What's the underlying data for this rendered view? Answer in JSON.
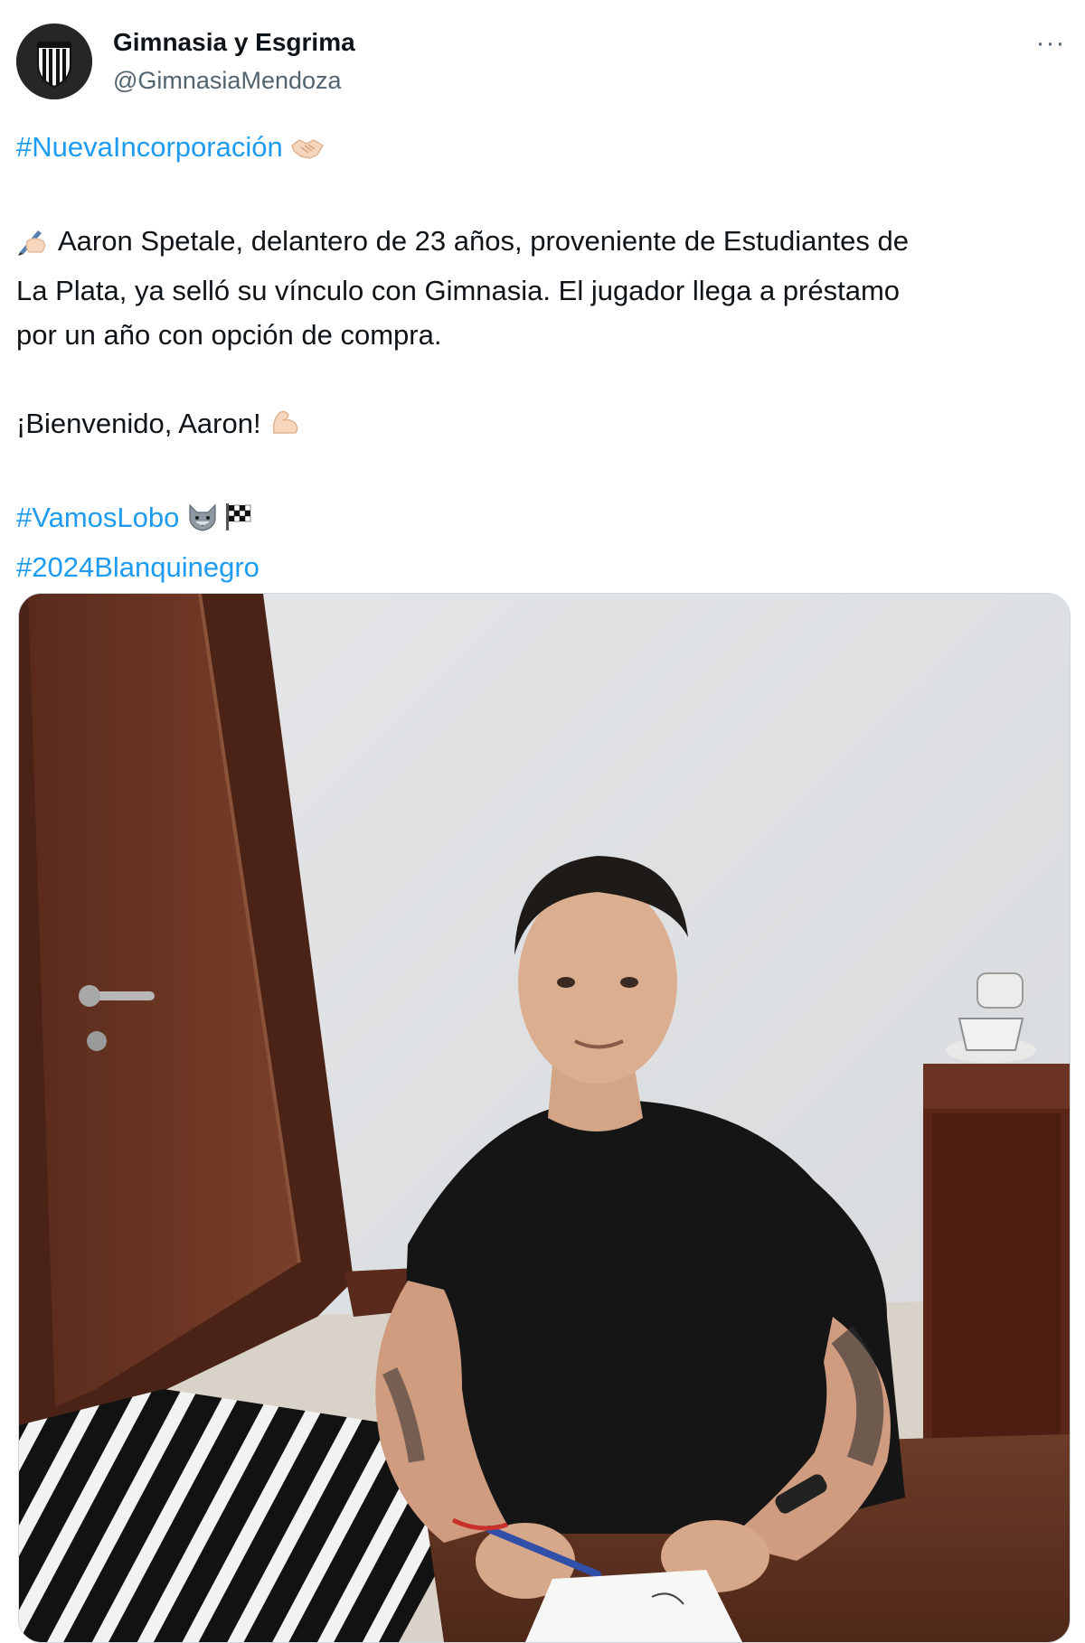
{
  "author": {
    "display_name": "Gimnasia y Esgrima",
    "handle": "@GimnasiaMendoza",
    "avatar_icon": "club-crest-icon"
  },
  "menu": {
    "more_label": "···"
  },
  "tweet": {
    "hashtag_1": "#NuevaIncorporación",
    "paragraph_line_1": "Aaron Spetale, delantero de 23 años, proveniente de Estudiantes de",
    "paragraph_line_2": "La Plata, ya selló su vínculo con Gimnasia. El jugador llega a préstamo",
    "paragraph_line_3": "por un año con opción de compra.",
    "welcome": "¡Bienvenido, Aaron!",
    "hashtag_2": "#VamosLobo",
    "hashtag_3": "#2024Blanquinegro"
  },
  "icons": {
    "handshake": "handshake-icon",
    "writing": "writing-hand-icon",
    "muscle": "flexed-biceps-icon",
    "wolf": "wolf-icon",
    "flag": "checkered-flag-icon"
  },
  "colors": {
    "link": "#1d9bf0",
    "secondary_text": "#536471",
    "primary_text": "#0f1419"
  },
  "media": {
    "kind": "photo",
    "subject": "player-signing-contract"
  }
}
